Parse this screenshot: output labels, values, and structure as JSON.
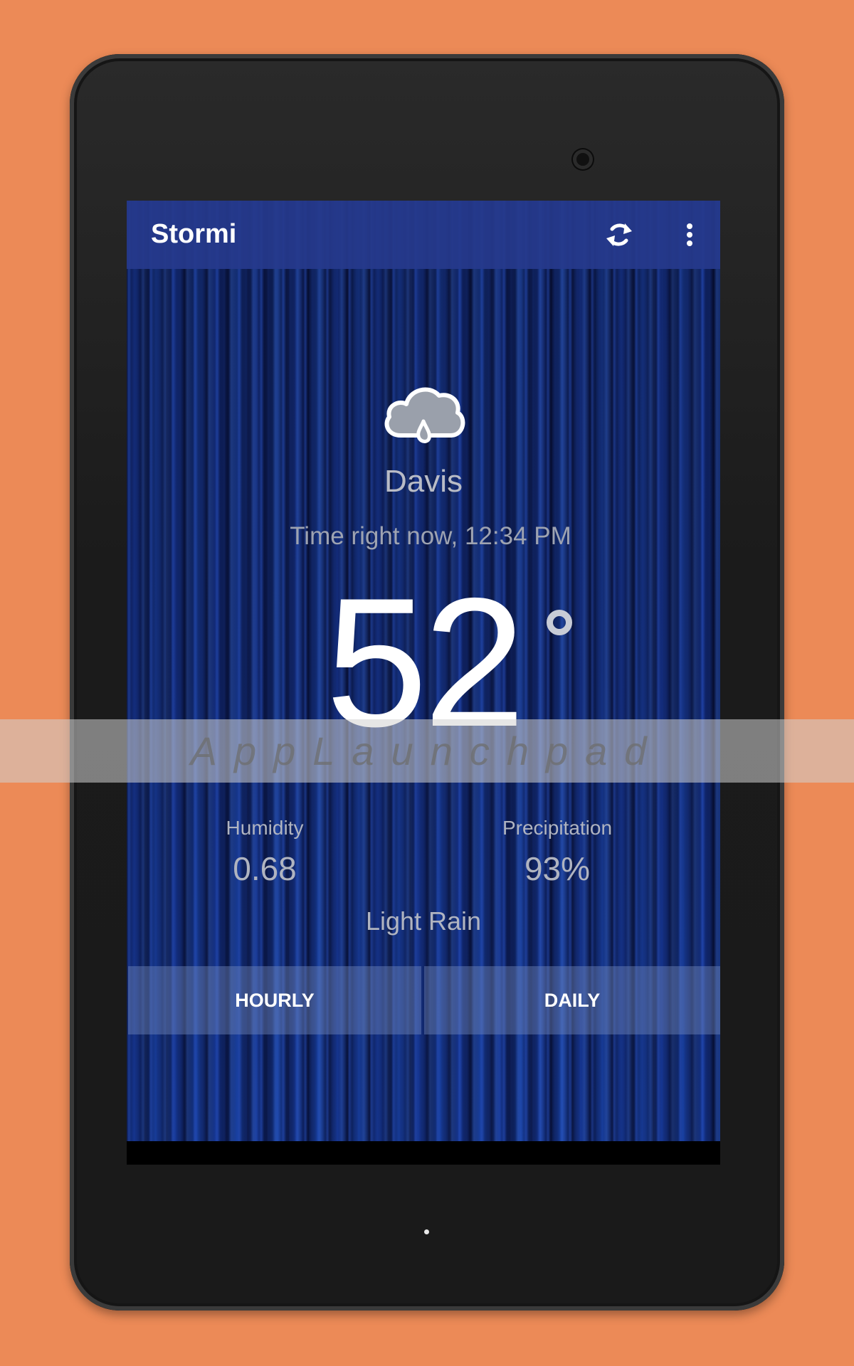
{
  "app": {
    "title": "Stormi",
    "actions": [
      {
        "name": "refresh-icon"
      },
      {
        "name": "more-vert-icon"
      }
    ]
  },
  "weather": {
    "icon": "cloud-rain-icon",
    "city": "Davis",
    "time_text": "Time right now, 12:34 PM",
    "temperature": "52",
    "humidity_label": "Humidity",
    "humidity_value": "0.68",
    "precip_label": "Precipitation",
    "precip_value": "93%",
    "summary": "Light Rain"
  },
  "tabs": {
    "hourly": "HOURLY",
    "daily": "DAILY"
  },
  "watermark": "AppLaunchpad",
  "colors": {
    "page_bg": "#ec8a57",
    "appbar": "#263a8c",
    "text_muted": "#b0b4c0"
  }
}
